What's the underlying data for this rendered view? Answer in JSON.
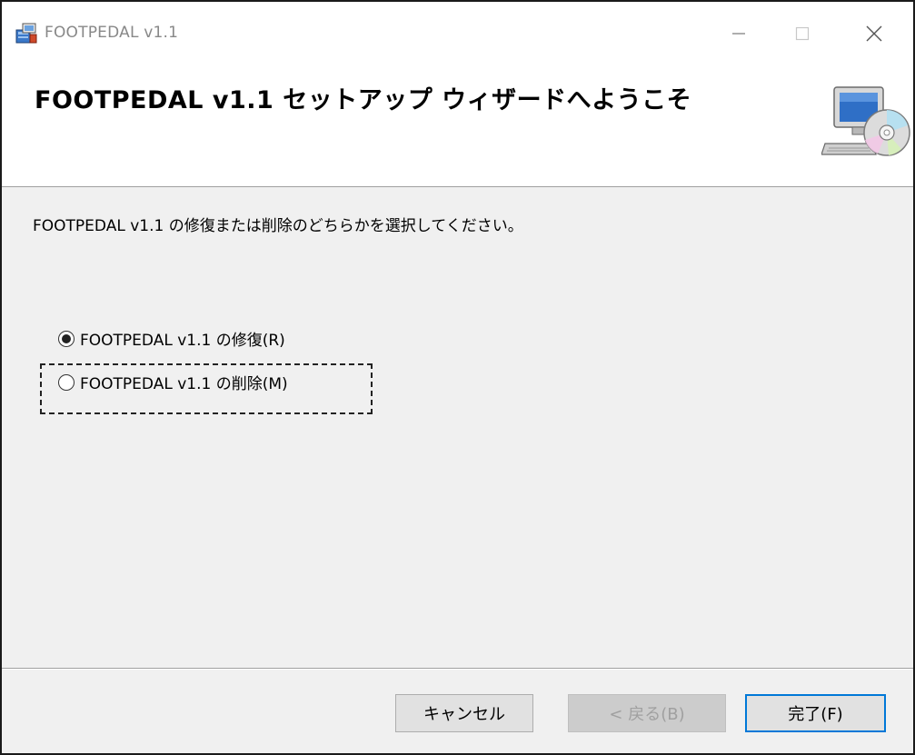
{
  "window": {
    "title": "FOOTPEDAL v1.1",
    "controls": {
      "minimize_icon": "minimize-icon",
      "maximize_icon": "maximize-icon",
      "close_icon": "close-icon"
    }
  },
  "banner": {
    "title": "FOOTPEDAL v1.1 セットアップ ウィザードへようこそ",
    "icon": "computer-cd-icon"
  },
  "main": {
    "instruction": "FOOTPEDAL v1.1 の修復または削除のどちらかを選択してください。",
    "options": [
      {
        "label": "FOOTPEDAL v1.1 の修復(R)",
        "selected": true
      },
      {
        "label": "FOOTPEDAL v1.1 の削除(M)",
        "selected": false,
        "focused": true
      }
    ]
  },
  "buttons": {
    "cancel": "キャンセル",
    "back": "< 戻る(B)",
    "finish": "完了(F)"
  },
  "colors": {
    "accent": "#0078d7",
    "dialog_bg": "#f0f0f0",
    "disabled_text": "#a0a0a0"
  }
}
